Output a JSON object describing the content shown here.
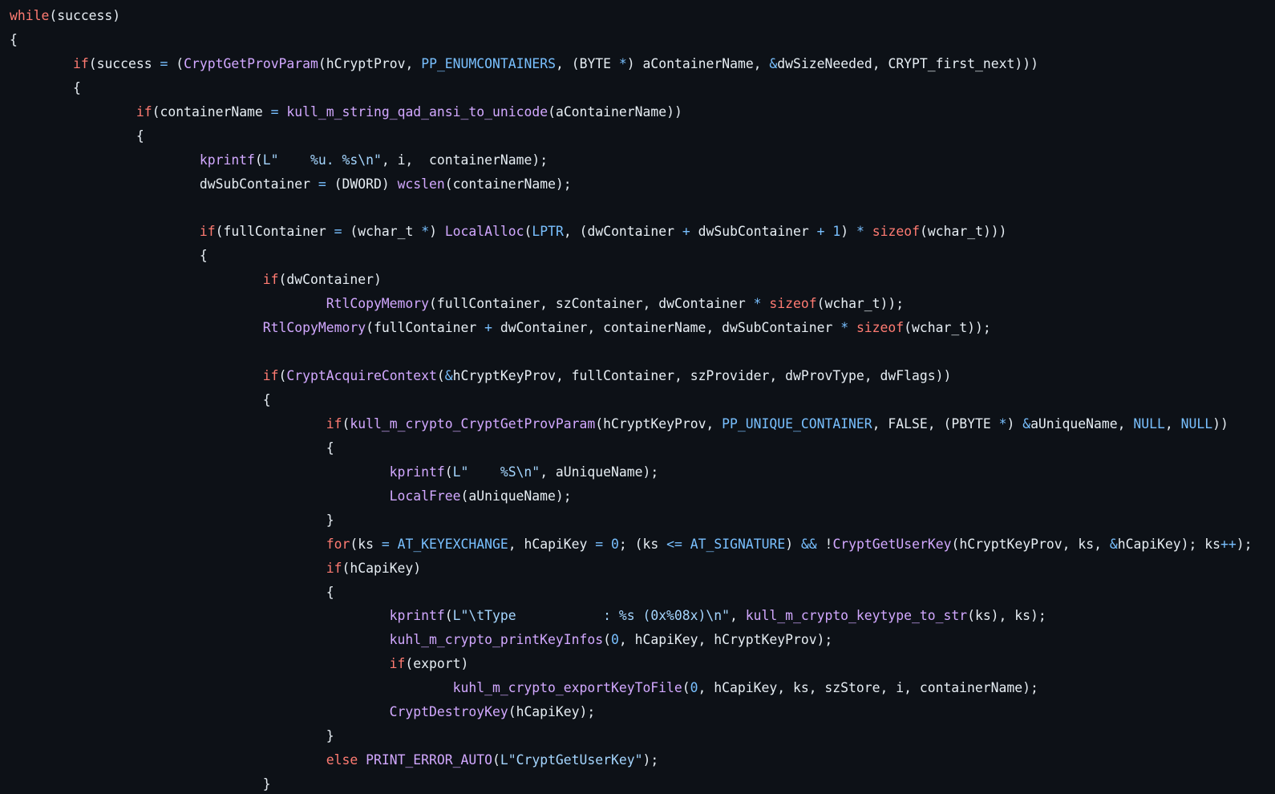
{
  "theme": {
    "background": "#0d1117",
    "text": "#e6edf3",
    "keyword": "#ff7b72",
    "function": "#d2a8ff",
    "constant": "#79c0ff",
    "string": "#a5d6ff"
  },
  "code": {
    "language": "c",
    "tab_size": 8,
    "lines": [
      [
        {
          "t": "kw",
          "v": "while"
        },
        {
          "t": "tx",
          "v": "(success)"
        }
      ],
      [
        {
          "t": "tx",
          "v": "{"
        }
      ],
      [
        {
          "t": "tx",
          "v": "\t"
        },
        {
          "t": "kw",
          "v": "if"
        },
        {
          "t": "tx",
          "v": "(success "
        },
        {
          "t": "op",
          "v": "="
        },
        {
          "t": "tx",
          "v": " ("
        },
        {
          "t": "fn",
          "v": "CryptGetProvParam"
        },
        {
          "t": "tx",
          "v": "(hCryptProv, "
        },
        {
          "t": "cst",
          "v": "PP_ENUMCONTAINERS"
        },
        {
          "t": "tx",
          "v": ", (BYTE "
        },
        {
          "t": "op",
          "v": "*"
        },
        {
          "t": "tx",
          "v": ") aContainerName, "
        },
        {
          "t": "op",
          "v": "&"
        },
        {
          "t": "tx",
          "v": "dwSizeNeeded, CRYPT_first_next)))"
        }
      ],
      [
        {
          "t": "tx",
          "v": "\t{"
        }
      ],
      [
        {
          "t": "tx",
          "v": "\t\t"
        },
        {
          "t": "kw",
          "v": "if"
        },
        {
          "t": "tx",
          "v": "(containerName "
        },
        {
          "t": "op",
          "v": "="
        },
        {
          "t": "tx",
          "v": " "
        },
        {
          "t": "fn",
          "v": "kull_m_string_qad_ansi_to_unicode"
        },
        {
          "t": "tx",
          "v": "(aContainerName))"
        }
      ],
      [
        {
          "t": "tx",
          "v": "\t\t{"
        }
      ],
      [
        {
          "t": "tx",
          "v": "\t\t\t"
        },
        {
          "t": "fn",
          "v": "kprintf"
        },
        {
          "t": "tx",
          "v": "("
        },
        {
          "t": "str",
          "v": "L\"    %u. %s\\n\""
        },
        {
          "t": "tx",
          "v": ", i,  containerName);"
        }
      ],
      [
        {
          "t": "tx",
          "v": "\t\t\tdwSubContainer "
        },
        {
          "t": "op",
          "v": "="
        },
        {
          "t": "tx",
          "v": " (DWORD) "
        },
        {
          "t": "fn",
          "v": "wcslen"
        },
        {
          "t": "tx",
          "v": "(containerName);"
        }
      ],
      [],
      [
        {
          "t": "tx",
          "v": "\t\t\t"
        },
        {
          "t": "kw",
          "v": "if"
        },
        {
          "t": "tx",
          "v": "(fullContainer "
        },
        {
          "t": "op",
          "v": "="
        },
        {
          "t": "tx",
          "v": " (wchar_t "
        },
        {
          "t": "op",
          "v": "*"
        },
        {
          "t": "tx",
          "v": ") "
        },
        {
          "t": "fn",
          "v": "LocalAlloc"
        },
        {
          "t": "tx",
          "v": "("
        },
        {
          "t": "cst",
          "v": "LPTR"
        },
        {
          "t": "tx",
          "v": ", (dwContainer "
        },
        {
          "t": "op",
          "v": "+"
        },
        {
          "t": "tx",
          "v": " dwSubContainer "
        },
        {
          "t": "op",
          "v": "+"
        },
        {
          "t": "tx",
          "v": " "
        },
        {
          "t": "num",
          "v": "1"
        },
        {
          "t": "tx",
          "v": ") "
        },
        {
          "t": "op",
          "v": "*"
        },
        {
          "t": "tx",
          "v": " "
        },
        {
          "t": "kw",
          "v": "sizeof"
        },
        {
          "t": "tx",
          "v": "(wchar_t)))"
        }
      ],
      [
        {
          "t": "tx",
          "v": "\t\t\t{"
        }
      ],
      [
        {
          "t": "tx",
          "v": "\t\t\t\t"
        },
        {
          "t": "kw",
          "v": "if"
        },
        {
          "t": "tx",
          "v": "(dwContainer)"
        }
      ],
      [
        {
          "t": "tx",
          "v": "\t\t\t\t\t"
        },
        {
          "t": "fn",
          "v": "RtlCopyMemory"
        },
        {
          "t": "tx",
          "v": "(fullContainer, szContainer, dwContainer "
        },
        {
          "t": "op",
          "v": "*"
        },
        {
          "t": "tx",
          "v": " "
        },
        {
          "t": "kw",
          "v": "sizeof"
        },
        {
          "t": "tx",
          "v": "(wchar_t));"
        }
      ],
      [
        {
          "t": "tx",
          "v": "\t\t\t\t"
        },
        {
          "t": "fn",
          "v": "RtlCopyMemory"
        },
        {
          "t": "tx",
          "v": "(fullContainer "
        },
        {
          "t": "op",
          "v": "+"
        },
        {
          "t": "tx",
          "v": " dwContainer, containerName, dwSubContainer "
        },
        {
          "t": "op",
          "v": "*"
        },
        {
          "t": "tx",
          "v": " "
        },
        {
          "t": "kw",
          "v": "sizeof"
        },
        {
          "t": "tx",
          "v": "(wchar_t));"
        }
      ],
      [],
      [
        {
          "t": "tx",
          "v": "\t\t\t\t"
        },
        {
          "t": "kw",
          "v": "if"
        },
        {
          "t": "tx",
          "v": "("
        },
        {
          "t": "fn",
          "v": "CryptAcquireContext"
        },
        {
          "t": "tx",
          "v": "("
        },
        {
          "t": "op",
          "v": "&"
        },
        {
          "t": "tx",
          "v": "hCryptKeyProv, fullContainer, szProvider, dwProvType, dwFlags))"
        }
      ],
      [
        {
          "t": "tx",
          "v": "\t\t\t\t{"
        }
      ],
      [
        {
          "t": "tx",
          "v": "\t\t\t\t\t"
        },
        {
          "t": "kw",
          "v": "if"
        },
        {
          "t": "tx",
          "v": "("
        },
        {
          "t": "fn",
          "v": "kull_m_crypto_CryptGetProvParam"
        },
        {
          "t": "tx",
          "v": "(hCryptKeyProv, "
        },
        {
          "t": "cst",
          "v": "PP_UNIQUE_CONTAINER"
        },
        {
          "t": "tx",
          "v": ", FALSE, (PBYTE "
        },
        {
          "t": "op",
          "v": "*"
        },
        {
          "t": "tx",
          "v": ") "
        },
        {
          "t": "op",
          "v": "&"
        },
        {
          "t": "tx",
          "v": "aUniqueName, "
        },
        {
          "t": "cst",
          "v": "NULL"
        },
        {
          "t": "tx",
          "v": ", "
        },
        {
          "t": "cst",
          "v": "NULL"
        },
        {
          "t": "tx",
          "v": "))"
        }
      ],
      [
        {
          "t": "tx",
          "v": "\t\t\t\t\t{"
        }
      ],
      [
        {
          "t": "tx",
          "v": "\t\t\t\t\t\t"
        },
        {
          "t": "fn",
          "v": "kprintf"
        },
        {
          "t": "tx",
          "v": "("
        },
        {
          "t": "str",
          "v": "L\"    %S\\n\""
        },
        {
          "t": "tx",
          "v": ", aUniqueName);"
        }
      ],
      [
        {
          "t": "tx",
          "v": "\t\t\t\t\t\t"
        },
        {
          "t": "fn",
          "v": "LocalFree"
        },
        {
          "t": "tx",
          "v": "(aUniqueName);"
        }
      ],
      [
        {
          "t": "tx",
          "v": "\t\t\t\t\t}"
        }
      ],
      [
        {
          "t": "tx",
          "v": "\t\t\t\t\t"
        },
        {
          "t": "kw",
          "v": "for"
        },
        {
          "t": "tx",
          "v": "(ks "
        },
        {
          "t": "op",
          "v": "="
        },
        {
          "t": "tx",
          "v": " "
        },
        {
          "t": "cst",
          "v": "AT_KEYEXCHANGE"
        },
        {
          "t": "tx",
          "v": ", hCapiKey "
        },
        {
          "t": "op",
          "v": "="
        },
        {
          "t": "tx",
          "v": " "
        },
        {
          "t": "num",
          "v": "0"
        },
        {
          "t": "tx",
          "v": "; (ks "
        },
        {
          "t": "op",
          "v": "<="
        },
        {
          "t": "tx",
          "v": " "
        },
        {
          "t": "cst",
          "v": "AT_SIGNATURE"
        },
        {
          "t": "tx",
          "v": ") "
        },
        {
          "t": "op",
          "v": "&&"
        },
        {
          "t": "tx",
          "v": " !"
        },
        {
          "t": "fn",
          "v": "CryptGetUserKey"
        },
        {
          "t": "tx",
          "v": "(hCryptKeyProv, ks, "
        },
        {
          "t": "op",
          "v": "&"
        },
        {
          "t": "tx",
          "v": "hCapiKey); ks"
        },
        {
          "t": "op",
          "v": "++"
        },
        {
          "t": "tx",
          "v": ");"
        }
      ],
      [
        {
          "t": "tx",
          "v": "\t\t\t\t\t"
        },
        {
          "t": "kw",
          "v": "if"
        },
        {
          "t": "tx",
          "v": "(hCapiKey)"
        }
      ],
      [
        {
          "t": "tx",
          "v": "\t\t\t\t\t{"
        }
      ],
      [
        {
          "t": "tx",
          "v": "\t\t\t\t\t\t"
        },
        {
          "t": "fn",
          "v": "kprintf"
        },
        {
          "t": "tx",
          "v": "("
        },
        {
          "t": "str",
          "v": "L\"\\tType           : %s (0x%08x)\\n\""
        },
        {
          "t": "tx",
          "v": ", "
        },
        {
          "t": "fn",
          "v": "kull_m_crypto_keytype_to_str"
        },
        {
          "t": "tx",
          "v": "(ks), ks);"
        }
      ],
      [
        {
          "t": "tx",
          "v": "\t\t\t\t\t\t"
        },
        {
          "t": "fn",
          "v": "kuhl_m_crypto_printKeyInfos"
        },
        {
          "t": "tx",
          "v": "("
        },
        {
          "t": "num",
          "v": "0"
        },
        {
          "t": "tx",
          "v": ", hCapiKey, hCryptKeyProv);"
        }
      ],
      [
        {
          "t": "tx",
          "v": "\t\t\t\t\t\t"
        },
        {
          "t": "kw",
          "v": "if"
        },
        {
          "t": "tx",
          "v": "(export)"
        }
      ],
      [
        {
          "t": "tx",
          "v": "\t\t\t\t\t\t\t"
        },
        {
          "t": "fn",
          "v": "kuhl_m_crypto_exportKeyToFile"
        },
        {
          "t": "tx",
          "v": "("
        },
        {
          "t": "num",
          "v": "0"
        },
        {
          "t": "tx",
          "v": ", hCapiKey, ks, szStore, i, containerName);"
        }
      ],
      [
        {
          "t": "tx",
          "v": "\t\t\t\t\t\t"
        },
        {
          "t": "fn",
          "v": "CryptDestroyKey"
        },
        {
          "t": "tx",
          "v": "(hCapiKey);"
        }
      ],
      [
        {
          "t": "tx",
          "v": "\t\t\t\t\t}"
        }
      ],
      [
        {
          "t": "tx",
          "v": "\t\t\t\t\t"
        },
        {
          "t": "kw",
          "v": "else"
        },
        {
          "t": "tx",
          "v": " "
        },
        {
          "t": "fn",
          "v": "PRINT_ERROR_AUTO"
        },
        {
          "t": "tx",
          "v": "("
        },
        {
          "t": "str",
          "v": "L\"CryptGetUserKey\""
        },
        {
          "t": "tx",
          "v": ");"
        }
      ],
      [
        {
          "t": "tx",
          "v": "\t\t\t\t}"
        }
      ]
    ]
  }
}
